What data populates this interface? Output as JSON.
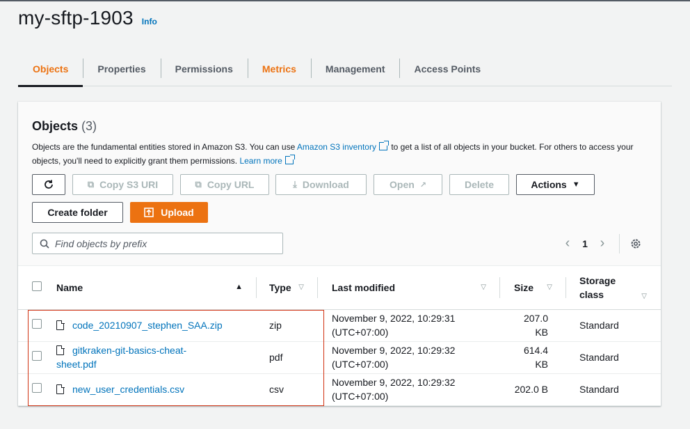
{
  "header": {
    "title": "my-sftp-1903",
    "info": "Info"
  },
  "tabs": [
    {
      "label": "Objects"
    },
    {
      "label": "Properties"
    },
    {
      "label": "Permissions"
    },
    {
      "label": "Metrics"
    },
    {
      "label": "Management"
    },
    {
      "label": "Access Points"
    }
  ],
  "objects": {
    "heading": "Objects",
    "count": "(3)",
    "description_1": "Objects are the fundamental entities stored in Amazon S3. You can use ",
    "inventory_link": "Amazon S3 inventory",
    "description_2": " to get a list of all objects in your bucket. For others to access your objects, you'll need to explicitly grant them permissions. ",
    "learn_more": "Learn more"
  },
  "toolbar": {
    "copy_s3_uri": "Copy S3 URI",
    "copy_url": "Copy URL",
    "download": "Download",
    "open": "Open",
    "delete": "Delete",
    "actions": "Actions",
    "create_folder": "Create folder",
    "upload": "Upload"
  },
  "search": {
    "placeholder": "Find objects by prefix"
  },
  "pagination": {
    "current_page": "1"
  },
  "table": {
    "columns": {
      "name": "Name",
      "type": "Type",
      "last_modified": "Last modified",
      "size": "Size",
      "storage_class_1": "Storage",
      "storage_class_2": "class"
    },
    "rows": [
      {
        "name": "code_20210907_stephen_SAA.zip",
        "type": "zip",
        "modified_1": "November 9, 2022, 10:29:31",
        "modified_2": "(UTC+07:00)",
        "size_1": "207.0",
        "size_2": "KB",
        "storage": "Standard"
      },
      {
        "name_1": "gitkraken-git-basics-cheat-",
        "name_2": "sheet.pdf",
        "type": "pdf",
        "modified_1": "November 9, 2022, 10:29:32",
        "modified_2": "(UTC+07:00)",
        "size_1": "614.4",
        "size_2": "KB",
        "storage": "Standard"
      },
      {
        "name": "new_user_credentials.csv",
        "type": "csv",
        "modified_1": "November 9, 2022, 10:29:32",
        "modified_2": "(UTC+07:00)",
        "size_1": "202.0 B",
        "size_2": "",
        "storage": "Standard"
      }
    ]
  },
  "colors": {
    "accent": "#ec7211",
    "link": "#0073bb",
    "highlight": "#d13212"
  }
}
